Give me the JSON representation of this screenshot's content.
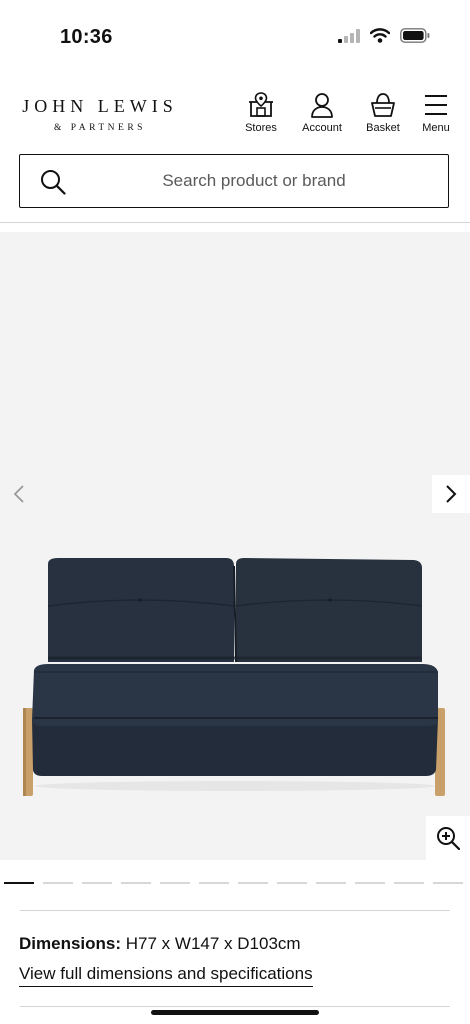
{
  "status_bar": {
    "time": "10:36"
  },
  "header": {
    "logo_main": "JOHN LEWIS",
    "logo_sub": "& PARTNERS",
    "nav": {
      "stores": "Stores",
      "account": "Account",
      "basket": "Basket",
      "menu": "Menu"
    }
  },
  "search": {
    "placeholder": "Search product or brand"
  },
  "gallery": {
    "image_count": 12,
    "active_index": 0,
    "colors": {
      "background": "#f3f3f3",
      "upholstery": "#263140",
      "legs": "#c9a06a"
    }
  },
  "product": {
    "dimensions_label": "Dimensions:",
    "dimensions_value": "H77 x W147 x D103cm",
    "spec_link": "View full dimensions and specifications"
  }
}
